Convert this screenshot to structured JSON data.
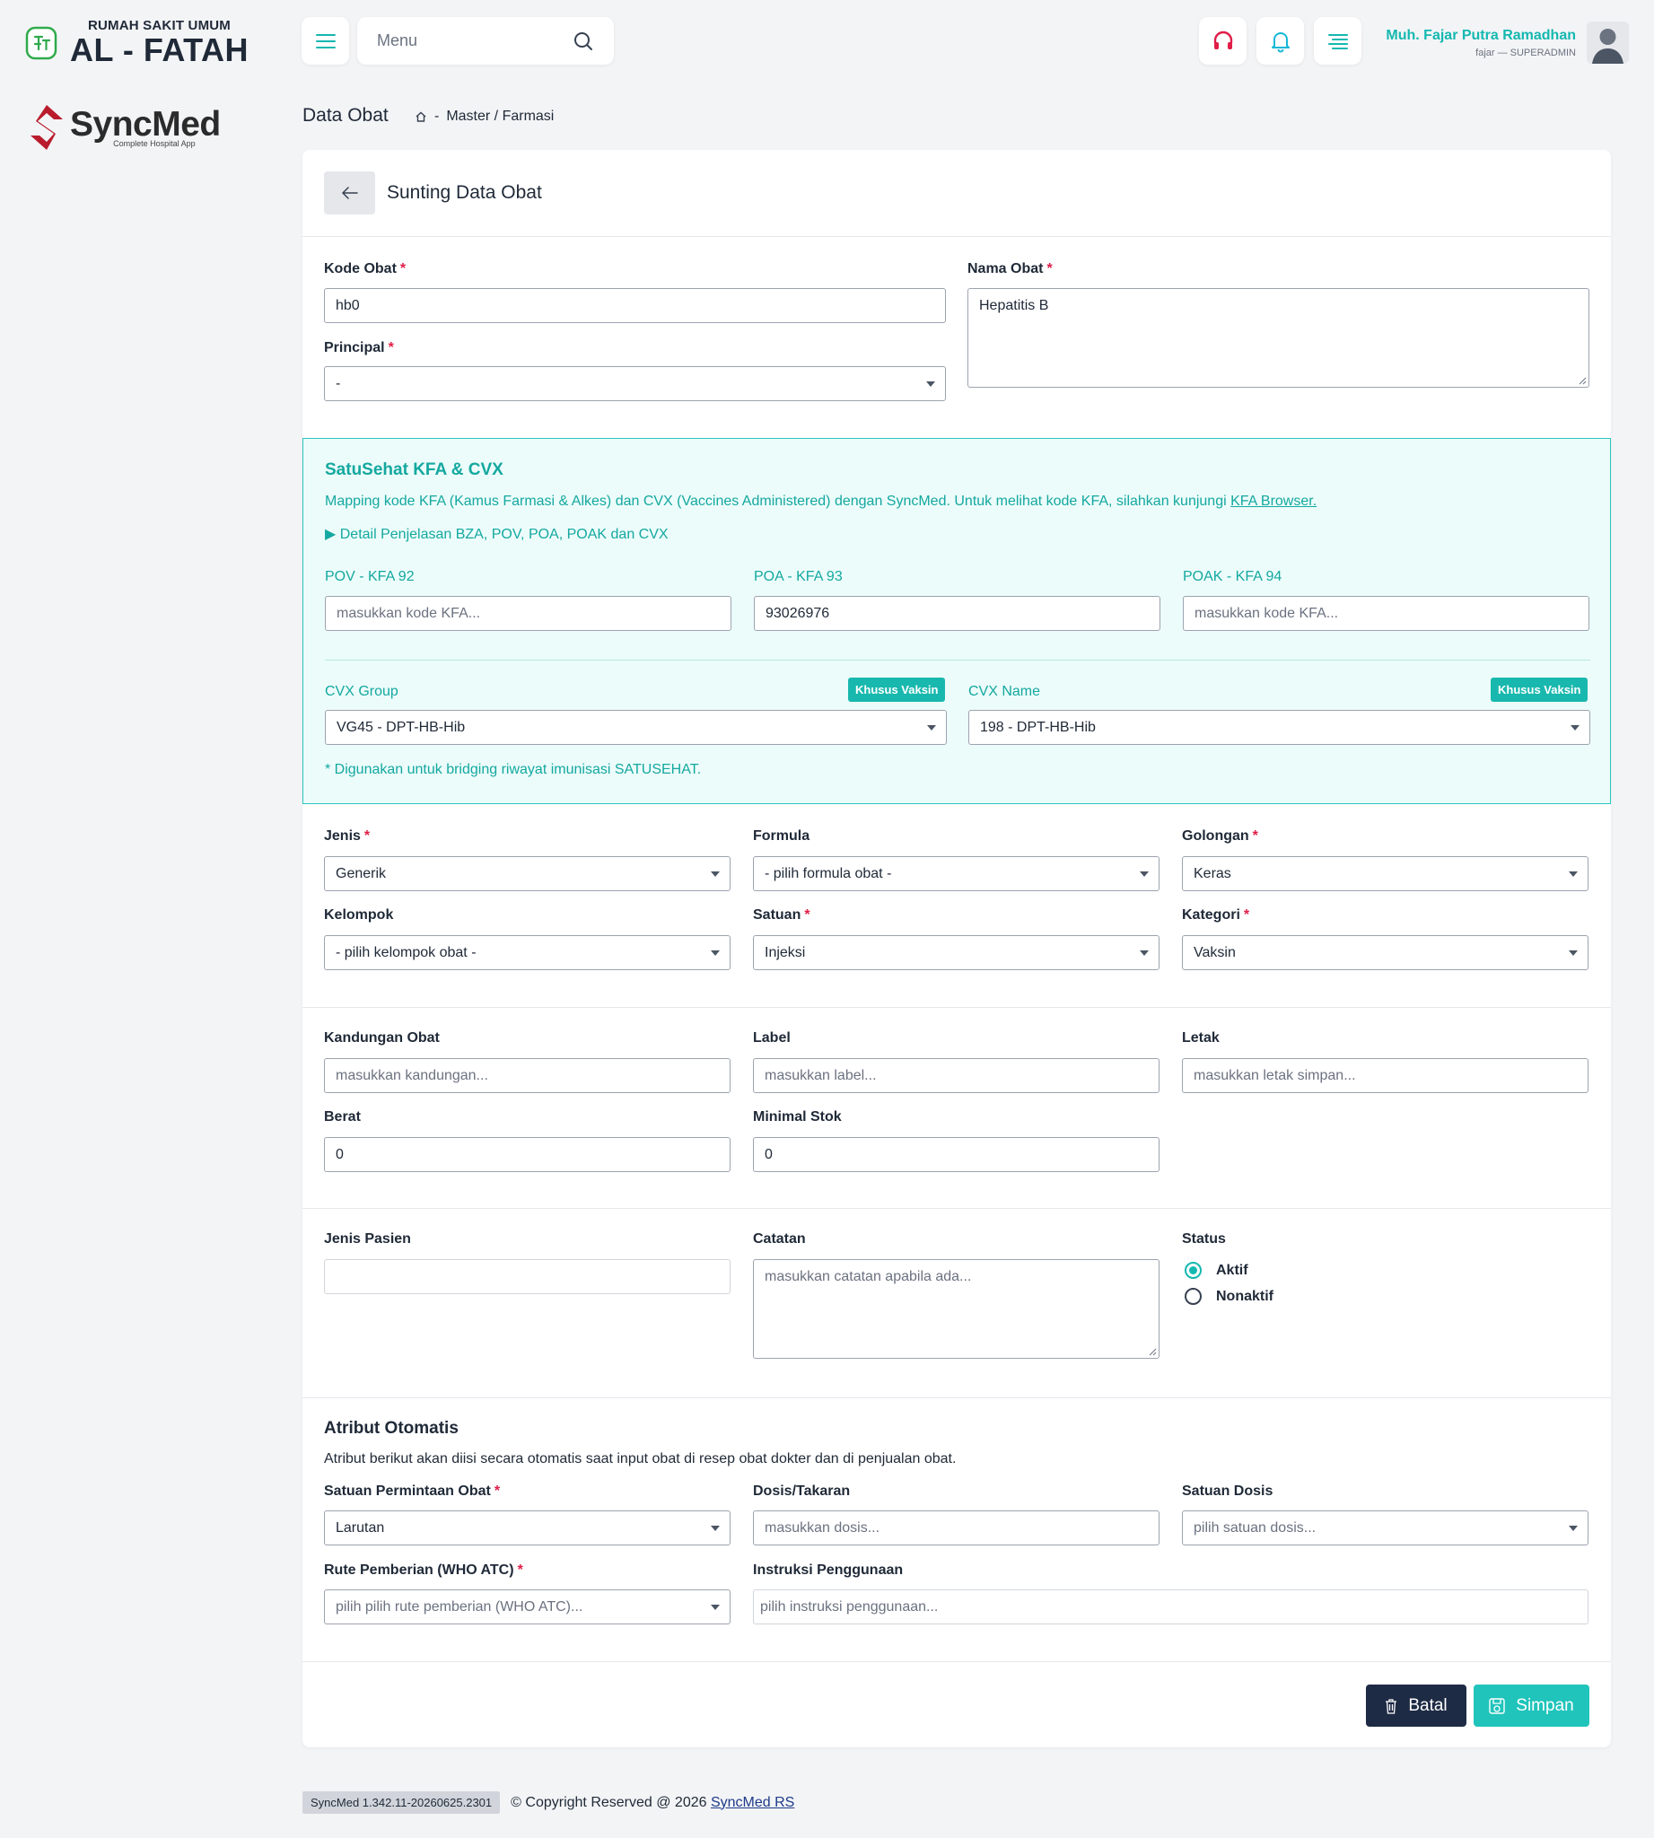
{
  "hospital": {
    "line1": "RUMAH SAKIT UMUM",
    "line2": "AL - FATAH"
  },
  "brand": {
    "name": "SyncMed",
    "tagline": "Complete Hospital App",
    "color": "#b91c2c"
  },
  "topbar": {
    "menu_placeholder": "Menu",
    "icons": [
      "hamburger-icon",
      "search-icon",
      "headset-icon",
      "bell-icon",
      "list-icon"
    ],
    "user_name": "Muh. Fajar Putra Ramadhan",
    "user_role": "fajar — SUPERADMIN"
  },
  "breadcrumb": {
    "title": "Data Obat",
    "path": "Master / Farmasi",
    "separator": "-"
  },
  "card": {
    "title": "Sunting Data Obat"
  },
  "form": {
    "kode_obat": {
      "label": "Kode Obat",
      "value": "hb0"
    },
    "nama_obat": {
      "label": "Nama Obat",
      "value": "Hepatitis B"
    },
    "principal": {
      "label": "Principal",
      "value": "-"
    },
    "jenis": {
      "label": "Jenis",
      "value": "Generik"
    },
    "formula": {
      "label": "Formula",
      "value": "- pilih formula obat -"
    },
    "golongan": {
      "label": "Golongan",
      "value": "Keras"
    },
    "kelompok": {
      "label": "Kelompok",
      "value": "- pilih kelompok obat -"
    },
    "satuan": {
      "label": "Satuan",
      "value": "Injeksi"
    },
    "kategori": {
      "label": "Kategori",
      "value": "Vaksin"
    },
    "kandungan": {
      "label": "Kandungan Obat",
      "placeholder": "masukkan kandungan..."
    },
    "label_obat": {
      "label": "Label",
      "placeholder": "masukkan label..."
    },
    "letak": {
      "label": "Letak",
      "placeholder": "masukkan letak simpan..."
    },
    "berat": {
      "label": "Berat",
      "value": "0"
    },
    "minimal_stok": {
      "label": "Minimal Stok",
      "value": "0"
    },
    "jenis_pasien": {
      "label": "Jenis Pasien",
      "value": ""
    },
    "catatan": {
      "label": "Catatan",
      "placeholder": "masukkan catatan apabila ada..."
    },
    "status": {
      "label": "Status",
      "options": [
        "Aktif",
        "Nonaktif"
      ],
      "selected": "Aktif"
    }
  },
  "satusehat": {
    "title": "SatuSehat KFA & CVX",
    "description": "Mapping kode KFA (Kamus Farmasi & Alkes) dan CVX (Vaccines Administered) dengan SyncMed. Untuk melihat kode KFA, silahkan kunjungi",
    "link_text": "KFA Browser.",
    "detail_toggle": "▶ Detail Penjelasan BZA, POV, POA, POAK dan CVX",
    "pov": {
      "label": "POV - KFA 92",
      "placeholder": "masukkan kode KFA..."
    },
    "poa": {
      "label": "POA - KFA 93",
      "value": "93026976"
    },
    "poak": {
      "label": "POAK - KFA 94",
      "placeholder": "masukkan kode KFA..."
    },
    "cvx_group": {
      "label": "CVX Group",
      "value": "VG45 - DPT-HB-Hib",
      "badge": "Khusus Vaksin"
    },
    "cvx_name": {
      "label": "CVX Name",
      "value": "198 - DPT-HB-Hib",
      "badge": "Khusus Vaksin"
    },
    "note": "* Digunakan untuk bridging riwayat imunisasi SATUSEHAT.",
    "accent": "#14a8a0"
  },
  "atribut": {
    "title": "Atribut Otomatis",
    "description": "Atribut berikut akan diisi secara otomatis saat input obat di resep obat dokter dan di penjualan obat.",
    "satuan_permintaan": {
      "label": "Satuan Permintaan Obat",
      "value": "Larutan"
    },
    "dosis": {
      "label": "Dosis/Takaran",
      "placeholder": "masukkan dosis..."
    },
    "satuan_dosis": {
      "label": "Satuan Dosis",
      "placeholder": "pilih satuan dosis..."
    },
    "rute": {
      "label": "Rute Pemberian (WHO ATC)",
      "placeholder": "pilih pilih rute pemberian (WHO ATC)..."
    },
    "instruksi": {
      "label": "Instruksi Penggunaan",
      "placeholder": "pilih instruksi penggunaan..."
    }
  },
  "actions": {
    "batal": "Batal",
    "simpan": "Simpan"
  },
  "footer": {
    "version": "SyncMed 1.342.11-20260625.2301",
    "copyright": "© Copyright Reserved @ 2026",
    "link": "SyncMed RS"
  }
}
